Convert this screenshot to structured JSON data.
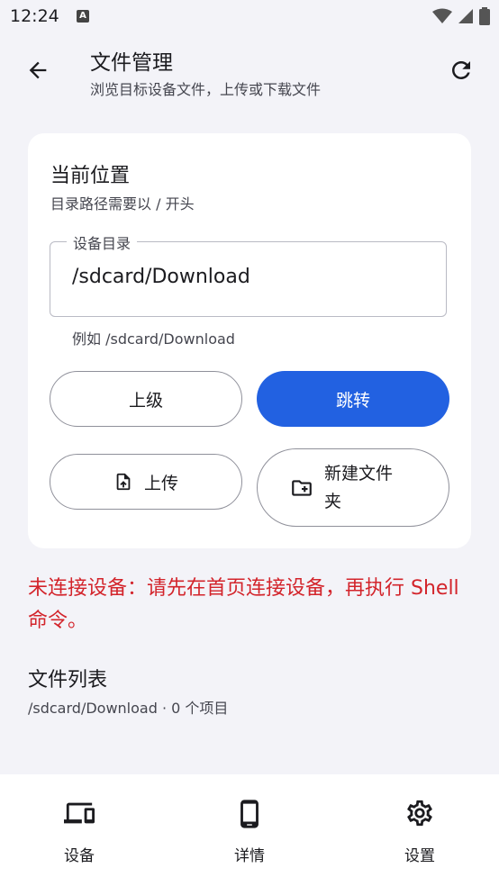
{
  "status_bar": {
    "time": "12:24",
    "notification_letter": "A"
  },
  "header": {
    "title": "文件管理",
    "subtitle": "浏览目标设备文件，上传或下载文件"
  },
  "location_card": {
    "title": "当前位置",
    "description": "目录路径需要以 / 开头",
    "field_label": "设备目录",
    "field_value": "/sdcard/Download",
    "hint": "例如 /sdcard/Download",
    "up_button": "上级",
    "go_button": "跳转",
    "upload_button": "上传",
    "new_folder_line1": "新建文件",
    "new_folder_line2": "夹"
  },
  "error_message": "未连接设备：请先在首页连接设备，再执行 Shell 命令。",
  "file_list": {
    "title": "文件列表",
    "meta": "/sdcard/Download · 0 个项目"
  },
  "bottom_nav": [
    {
      "label": "设备",
      "icon": "devices-icon"
    },
    {
      "label": "详情",
      "icon": "phone-icon"
    },
    {
      "label": "设置",
      "icon": "gear-icon"
    }
  ],
  "colors": {
    "accent": "#2261e1",
    "error": "#d3242b",
    "background": "#f3f3f8"
  }
}
